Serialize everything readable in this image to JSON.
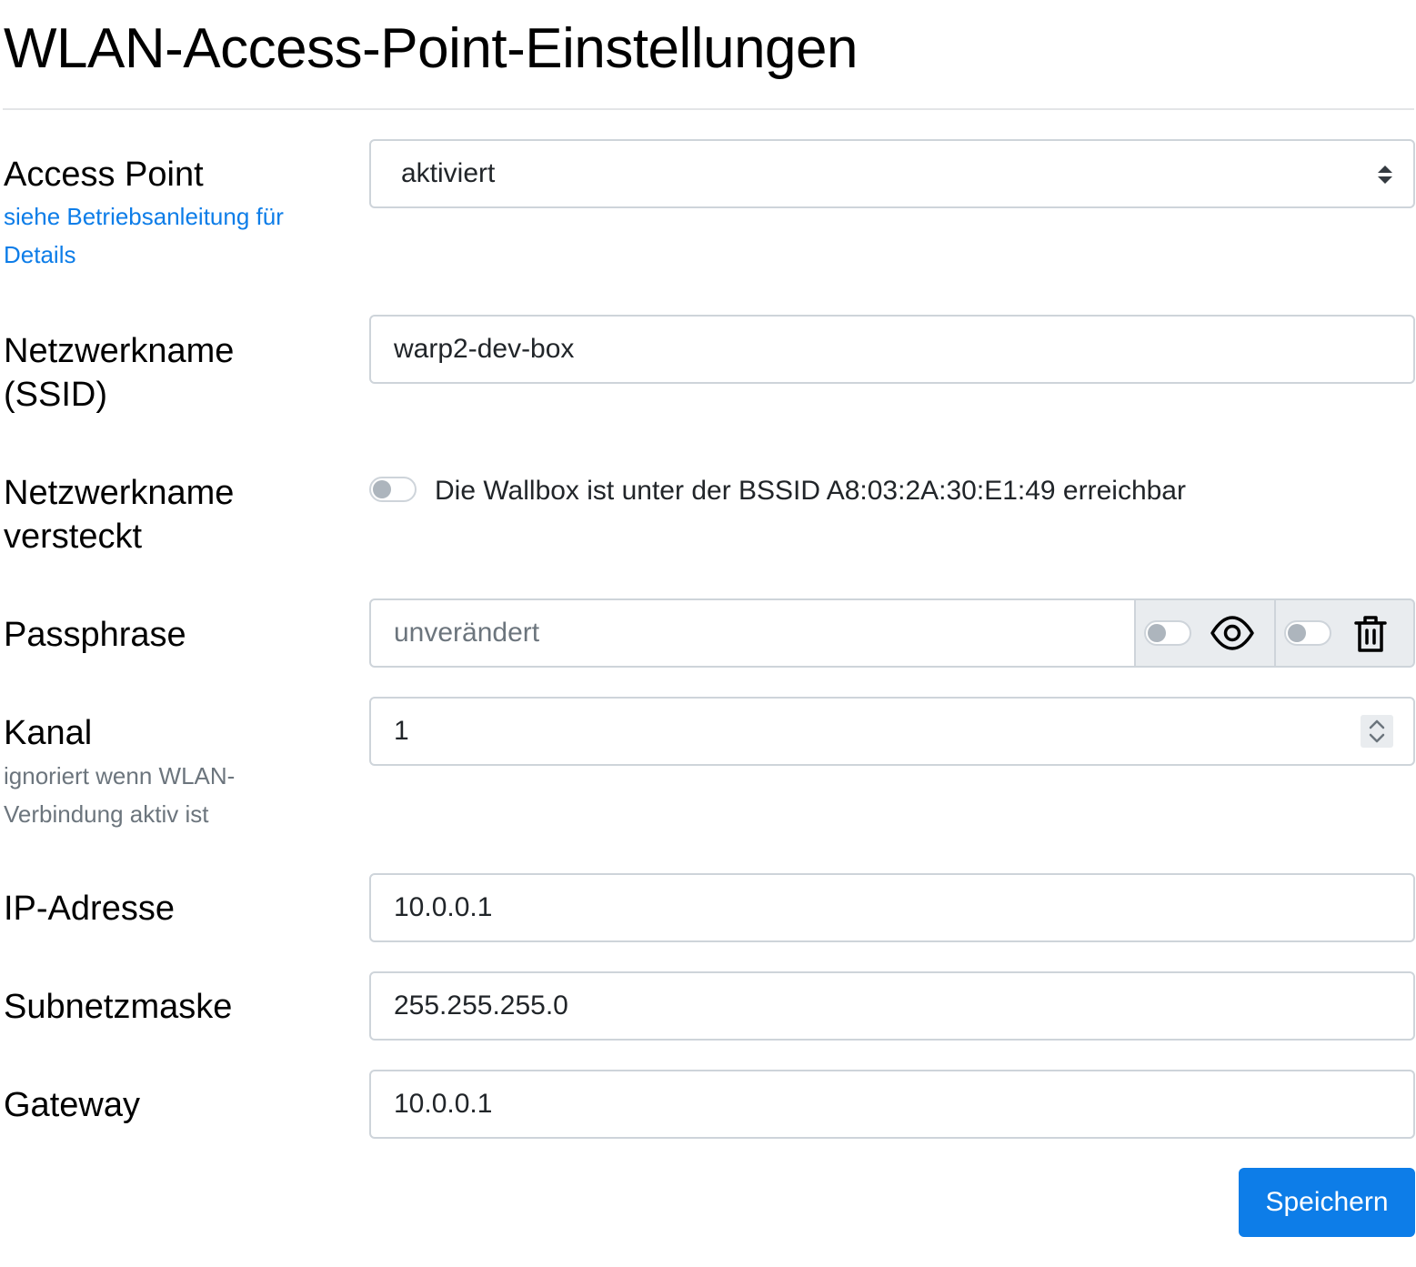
{
  "page": {
    "title": "WLAN-Access-Point-Einstellungen"
  },
  "access_point": {
    "label": "Access Point",
    "help_line1": "siehe Betriebsanleitung für",
    "help_line2": "Details",
    "value": "aktiviert"
  },
  "ssid": {
    "label_line1": "Netzwerkname",
    "label_line2": "(SSID)",
    "value": "warp2-dev-box"
  },
  "hide_ssid": {
    "label_line1": "Netzwerkname",
    "label_line2": "versteckt",
    "enabled": false,
    "description": "Die Wallbox ist unter der BSSID A8:03:2A:30:E1:49 erreichbar"
  },
  "passphrase": {
    "label": "Passphrase",
    "placeholder": "unverändert",
    "show_enabled": false,
    "clear_enabled": false,
    "show_icon": "eye-icon",
    "clear_icon": "trash-icon"
  },
  "channel": {
    "label": "Kanal",
    "help_line1": "ignoriert wenn WLAN-",
    "help_line2": "Verbindung aktiv ist",
    "value": "1"
  },
  "ip": {
    "label": "IP-Adresse",
    "value": "10.0.0.1"
  },
  "subnet": {
    "label": "Subnetzmaske",
    "value": "255.255.255.0"
  },
  "gateway": {
    "label": "Gateway",
    "value": "10.0.0.1"
  },
  "actions": {
    "save_label": "Speichern"
  },
  "colors": {
    "primary": "#0d7de8",
    "border": "#ced4da",
    "addon_bg": "#e9ecef",
    "muted_text": "#6c757d"
  }
}
